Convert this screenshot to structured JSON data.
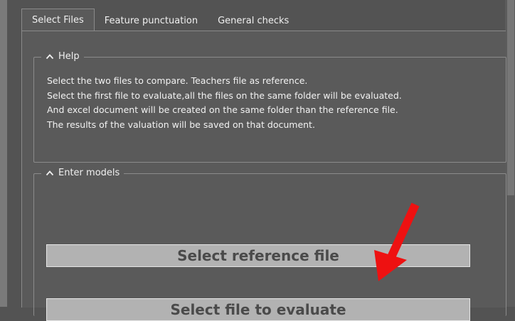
{
  "tabs": [
    {
      "label": "Select Files"
    },
    {
      "label": "Feature punctuation"
    },
    {
      "label": "General checks"
    }
  ],
  "help": {
    "title": "Help",
    "lines": [
      "Select the two files to compare. Teachers file as reference.",
      "Select the first file to evaluate,all the files on the same folder will be evaluated.",
      "And excel document will be created on the same folder than the reference  file.",
      "The results of the valuation will be saved on that document."
    ]
  },
  "models": {
    "title": "Enter models",
    "select_reference_label": "Select reference file",
    "select_evaluate_label": "Select file to evaluate"
  },
  "colors": {
    "arrow": "#ee1111",
    "background": "#5a5a5a",
    "button": "#b2b2b2"
  },
  "icons": {
    "collapse": "chevron-up-icon",
    "annotation": "red-arrow-icon"
  }
}
